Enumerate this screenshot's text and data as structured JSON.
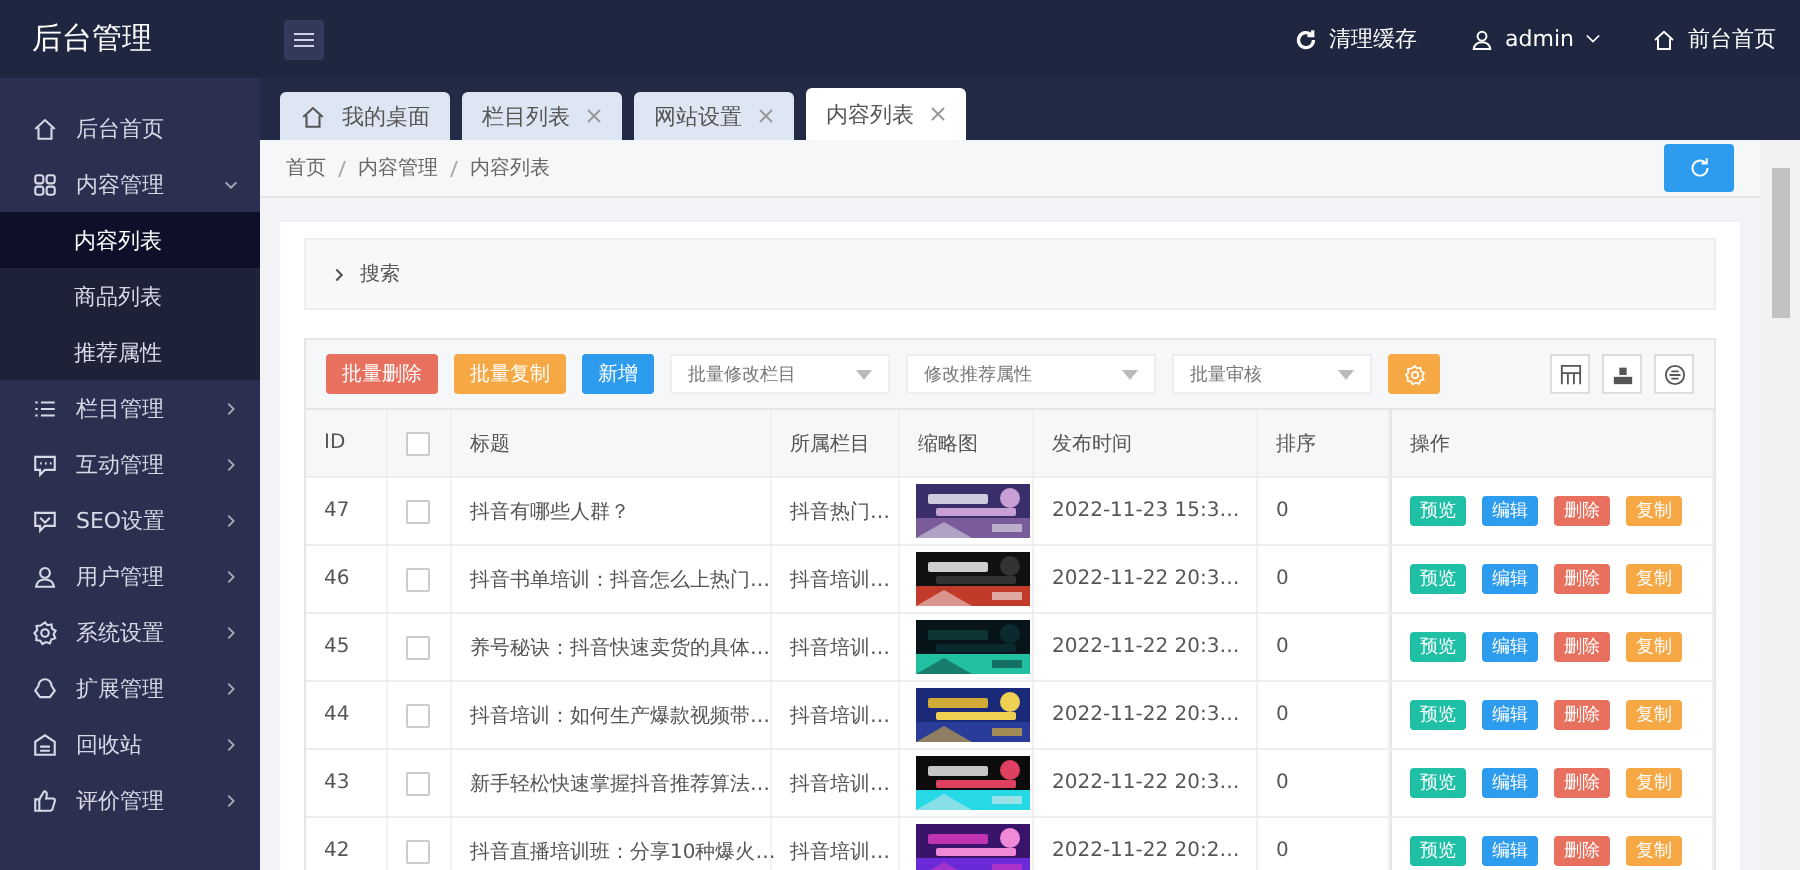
{
  "app": {
    "title": "后台管理"
  },
  "header": {
    "actions": [
      {
        "kind": "refresh",
        "label": "清理缓存"
      },
      {
        "kind": "user",
        "label": "admin"
      },
      {
        "kind": "home",
        "label": "前台首页"
      }
    ]
  },
  "sidebar": {
    "items": [
      {
        "label": "后台首页"
      },
      {
        "label": "内容管理",
        "expanded": true,
        "children": [
          {
            "label": "内容列表",
            "selected": true
          },
          {
            "label": "商品列表",
            "selected": false
          },
          {
            "label": "推荐属性",
            "selected": false
          }
        ]
      },
      {
        "label": "栏目管理",
        "expanded": false
      },
      {
        "label": "互动管理",
        "expanded": false
      },
      {
        "label": "SEO设置",
        "expanded": false
      },
      {
        "label": "用户管理",
        "expanded": false
      },
      {
        "label": "系统设置",
        "expanded": false
      },
      {
        "label": "扩展管理",
        "expanded": false
      },
      {
        "label": "回收站",
        "expanded": false
      },
      {
        "label": "评价管理",
        "expanded": false
      }
    ]
  },
  "tabs": [
    {
      "label": "我的桌面",
      "closable": false,
      "selected": false
    },
    {
      "label": "栏目列表",
      "closable": true,
      "selected": false
    },
    {
      "label": "网站设置",
      "closable": true,
      "selected": false
    },
    {
      "label": "内容列表",
      "closable": true,
      "selected": true
    }
  ],
  "breadcrumb": [
    "首页",
    "内容管理",
    "内容列表"
  ],
  "search_panel": {
    "label": "搜索",
    "expanded": false
  },
  "toolbar": {
    "buttons": [
      {
        "label": "批量删除",
        "color": "#e8705f"
      },
      {
        "label": "批量复制",
        "color": "#f5a844"
      },
      {
        "label": "新增",
        "color": "#2d9cee"
      }
    ],
    "selects": [
      {
        "placeholder": "批量修改栏目"
      },
      {
        "placeholder": "修改推荐属性"
      },
      {
        "placeholder": "批量审核"
      }
    ]
  },
  "table": {
    "columns": [
      {
        "kind": "text",
        "label": "ID"
      },
      {
        "kind": "checkbox",
        "checked": false
      },
      {
        "kind": "text",
        "label": "标题"
      },
      {
        "kind": "text",
        "label": "所属栏目"
      },
      {
        "kind": "text",
        "label": "缩略图"
      },
      {
        "kind": "text",
        "label": "发布时间"
      },
      {
        "kind": "text",
        "label": "排序"
      },
      {
        "kind": "text",
        "label": "操作"
      }
    ],
    "rows": [
      {
        "id": "47",
        "checked": false,
        "title": "抖音有哪些人群？",
        "category": "抖音热门…",
        "time": "2022-11-23 15:3…",
        "sort": "0",
        "actions": [
          {
            "label": "预览",
            "color": "#1fc0a6"
          },
          {
            "label": "编辑",
            "color": "#2d9cee"
          },
          {
            "label": "删除",
            "color": "#e8705f"
          },
          {
            "label": "复制",
            "color": "#f5a844"
          }
        ]
      },
      {
        "id": "46",
        "checked": false,
        "title": "抖音书单培训：抖音怎么上热门…",
        "category": "抖音培训…",
        "time": "2022-11-22 20:3…",
        "sort": "0",
        "actions": [
          {
            "label": "预览",
            "color": "#1fc0a6"
          },
          {
            "label": "编辑",
            "color": "#2d9cee"
          },
          {
            "label": "删除",
            "color": "#e8705f"
          },
          {
            "label": "复制",
            "color": "#f5a844"
          }
        ]
      },
      {
        "id": "45",
        "checked": false,
        "title": "养号秘诀：抖音快速卖货的具体…",
        "category": "抖音培训…",
        "time": "2022-11-22 20:3…",
        "sort": "0",
        "actions": [
          {
            "label": "预览",
            "color": "#1fc0a6"
          },
          {
            "label": "编辑",
            "color": "#2d9cee"
          },
          {
            "label": "删除",
            "color": "#e8705f"
          },
          {
            "label": "复制",
            "color": "#f5a844"
          }
        ]
      },
      {
        "id": "44",
        "checked": false,
        "title": "抖音培训：如何生产爆款视频带…",
        "category": "抖音培训…",
        "time": "2022-11-22 20:3…",
        "sort": "0",
        "actions": [
          {
            "label": "预览",
            "color": "#1fc0a6"
          },
          {
            "label": "编辑",
            "color": "#2d9cee"
          },
          {
            "label": "删除",
            "color": "#e8705f"
          },
          {
            "label": "复制",
            "color": "#f5a844"
          }
        ]
      },
      {
        "id": "43",
        "checked": false,
        "title": "新手轻松快速掌握抖音推荐算法…",
        "category": "抖音培训…",
        "time": "2022-11-22 20:3…",
        "sort": "0",
        "actions": [
          {
            "label": "预览",
            "color": "#1fc0a6"
          },
          {
            "label": "编辑",
            "color": "#2d9cee"
          },
          {
            "label": "删除",
            "color": "#e8705f"
          },
          {
            "label": "复制",
            "color": "#f5a844"
          }
        ]
      },
      {
        "id": "42",
        "checked": false,
        "title": "抖音直播培训班：分享10种爆火…",
        "category": "抖音培训…",
        "time": "2022-11-22 20:2…",
        "sort": "0",
        "actions": [
          {
            "label": "预览",
            "color": "#1fc0a6"
          },
          {
            "label": "编辑",
            "color": "#2d9cee"
          },
          {
            "label": "删除",
            "color": "#e8705f"
          },
          {
            "label": "复制",
            "color": "#f5a844"
          }
        ]
      }
    ]
  }
}
